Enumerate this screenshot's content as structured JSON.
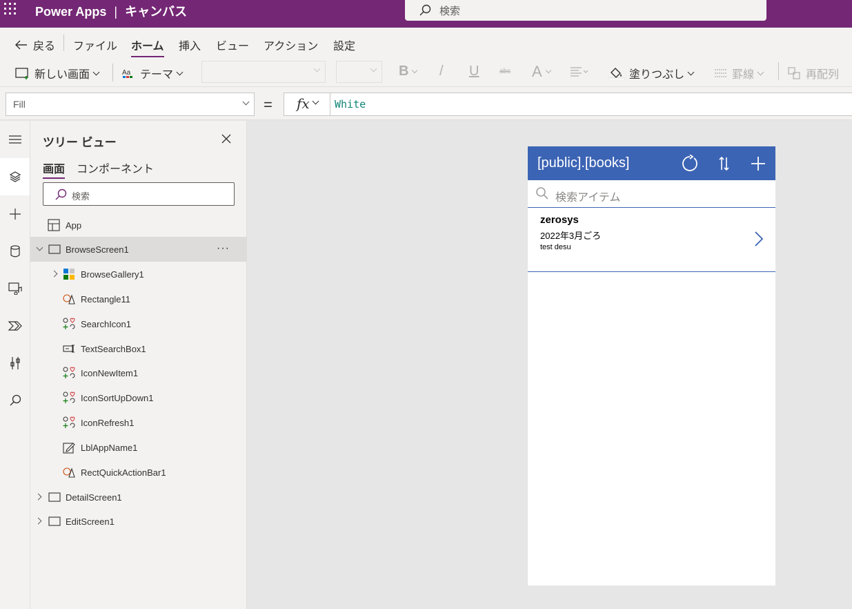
{
  "titlebar": {
    "app_name": "Power Apps",
    "separator": "|",
    "mode": "キャンバス",
    "search_placeholder": "検索"
  },
  "menu": {
    "back": "戻る",
    "items": [
      "ファイル",
      "ホーム",
      "挿入",
      "ビュー",
      "アクション",
      "設定"
    ],
    "active": "ホーム"
  },
  "toolbar": {
    "new_screen": "新しい画面",
    "theme": "テーマ",
    "bold": "B",
    "italic": "/",
    "underline": "U",
    "strike": "abc",
    "font_color": "A",
    "fill": "塗りつぶし",
    "border": "罫線",
    "reorder": "再配列"
  },
  "formula": {
    "property": "Fill",
    "equals": "=",
    "fx": "fx",
    "value": "White"
  },
  "rail": {
    "icons": [
      "hamburger-icon",
      "layers-icon",
      "plus-icon",
      "database-icon",
      "media-icon",
      "power-automate-icon",
      "tools-icon",
      "search-icon"
    ]
  },
  "tree": {
    "title": "ツリー ビュー",
    "tabs": [
      "画面",
      "コンポーネント"
    ],
    "search_placeholder": "検索",
    "nodes": [
      {
        "label": "App"
      },
      {
        "label": "BrowseScreen1",
        "more": "···"
      },
      {
        "label": "BrowseGallery1"
      },
      {
        "label": "Rectangle11"
      },
      {
        "label": "SearchIcon1"
      },
      {
        "label": "TextSearchBox1"
      },
      {
        "label": "IconNewItem1"
      },
      {
        "label": "IconSortUpDown1"
      },
      {
        "label": "IconRefresh1"
      },
      {
        "label": "LblAppName1"
      },
      {
        "label": "RectQuickActionBar1"
      },
      {
        "label": "DetailScreen1"
      },
      {
        "label": "EditScreen1"
      }
    ]
  },
  "app": {
    "title": "[public].[books]",
    "header_color": "#3c64b4",
    "search_placeholder": "検索アイテム",
    "gallery": [
      {
        "title": "zerosys",
        "subtitle": "2022年3月ごろ",
        "body": "test desu"
      }
    ]
  },
  "colors": {
    "brand": "#742774",
    "accent": "#3c64b4"
  }
}
